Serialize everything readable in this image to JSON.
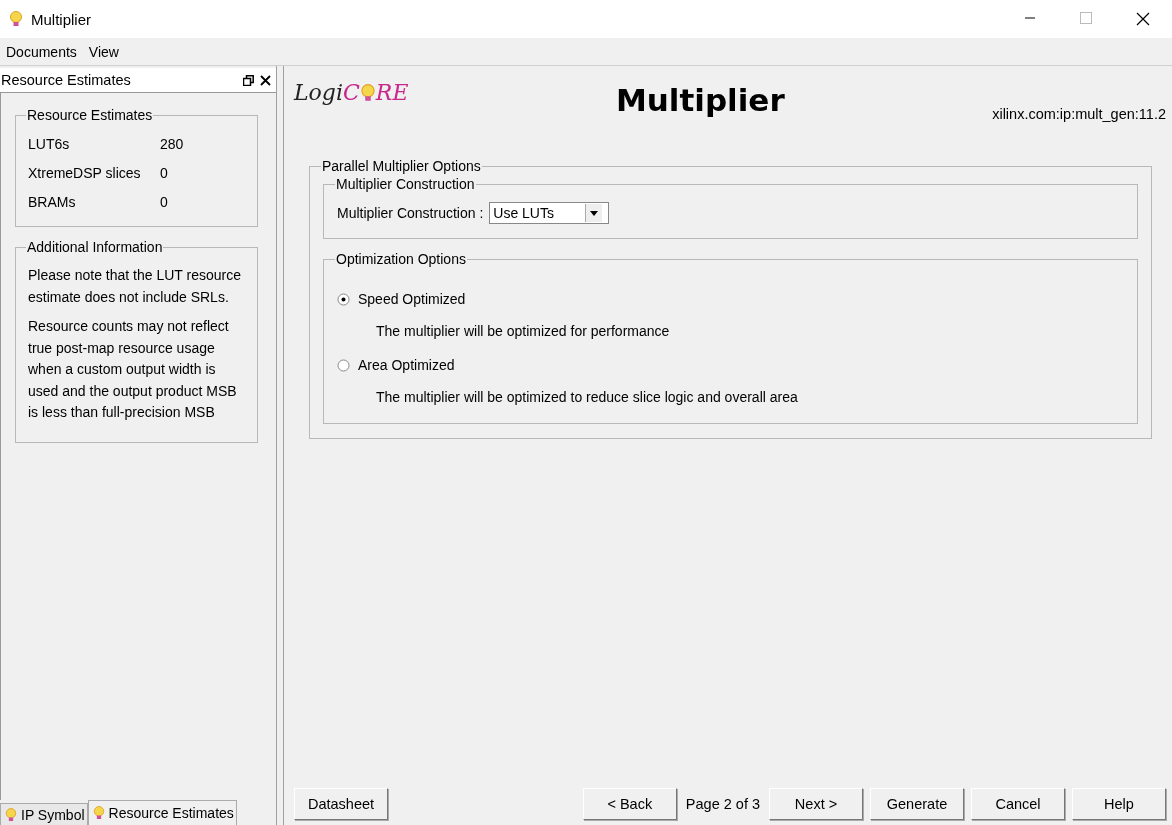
{
  "window": {
    "title": "Multiplier"
  },
  "menu": [
    "Documents",
    "View"
  ],
  "side_panel": {
    "title": "Resource Estimates",
    "estimates": {
      "title": "Resource Estimates",
      "rows": [
        {
          "label": "LUT6s",
          "value": "280"
        },
        {
          "label": "XtremeDSP slices",
          "value": "0"
        },
        {
          "label": "BRAMs",
          "value": "0"
        }
      ]
    },
    "info": {
      "title": "Additional Information",
      "paragraphs": [
        "Please note that the LUT resource estimate does not include SRLs.",
        "Resource counts may not reflect true post-map resource usage when a custom output width is used and the output product MSB is less than full-precision MSB"
      ]
    }
  },
  "side_tabs": [
    {
      "label": "IP Symbol",
      "selected": false
    },
    {
      "label": "Resource Estimates",
      "selected": true
    }
  ],
  "header": {
    "logo": {
      "dark": "Logi",
      "accent_before": "C",
      "accent_after": "RE"
    },
    "title": "Multiplier",
    "vlnv": "xilinx.com:ip:mult_gen:11.2"
  },
  "options": {
    "title": "Parallel Multiplier Options",
    "construction": {
      "title": "Multiplier Construction",
      "label": "Multiplier Construction :",
      "value": "Use LUTs"
    },
    "optimization": {
      "title": "Optimization Options",
      "choices": [
        {
          "label": "Speed Optimized",
          "description": "The multiplier will be optimized for performance",
          "selected": true
        },
        {
          "label": "Area Optimized",
          "description": "The multiplier will be optimized to reduce slice logic and overall area",
          "selected": false
        }
      ]
    }
  },
  "footer": {
    "datasheet": "Datasheet",
    "back": "< Back",
    "page": "Page 2 of 3",
    "buttons": [
      "Next >",
      "Generate",
      "Cancel",
      "Help"
    ]
  }
}
